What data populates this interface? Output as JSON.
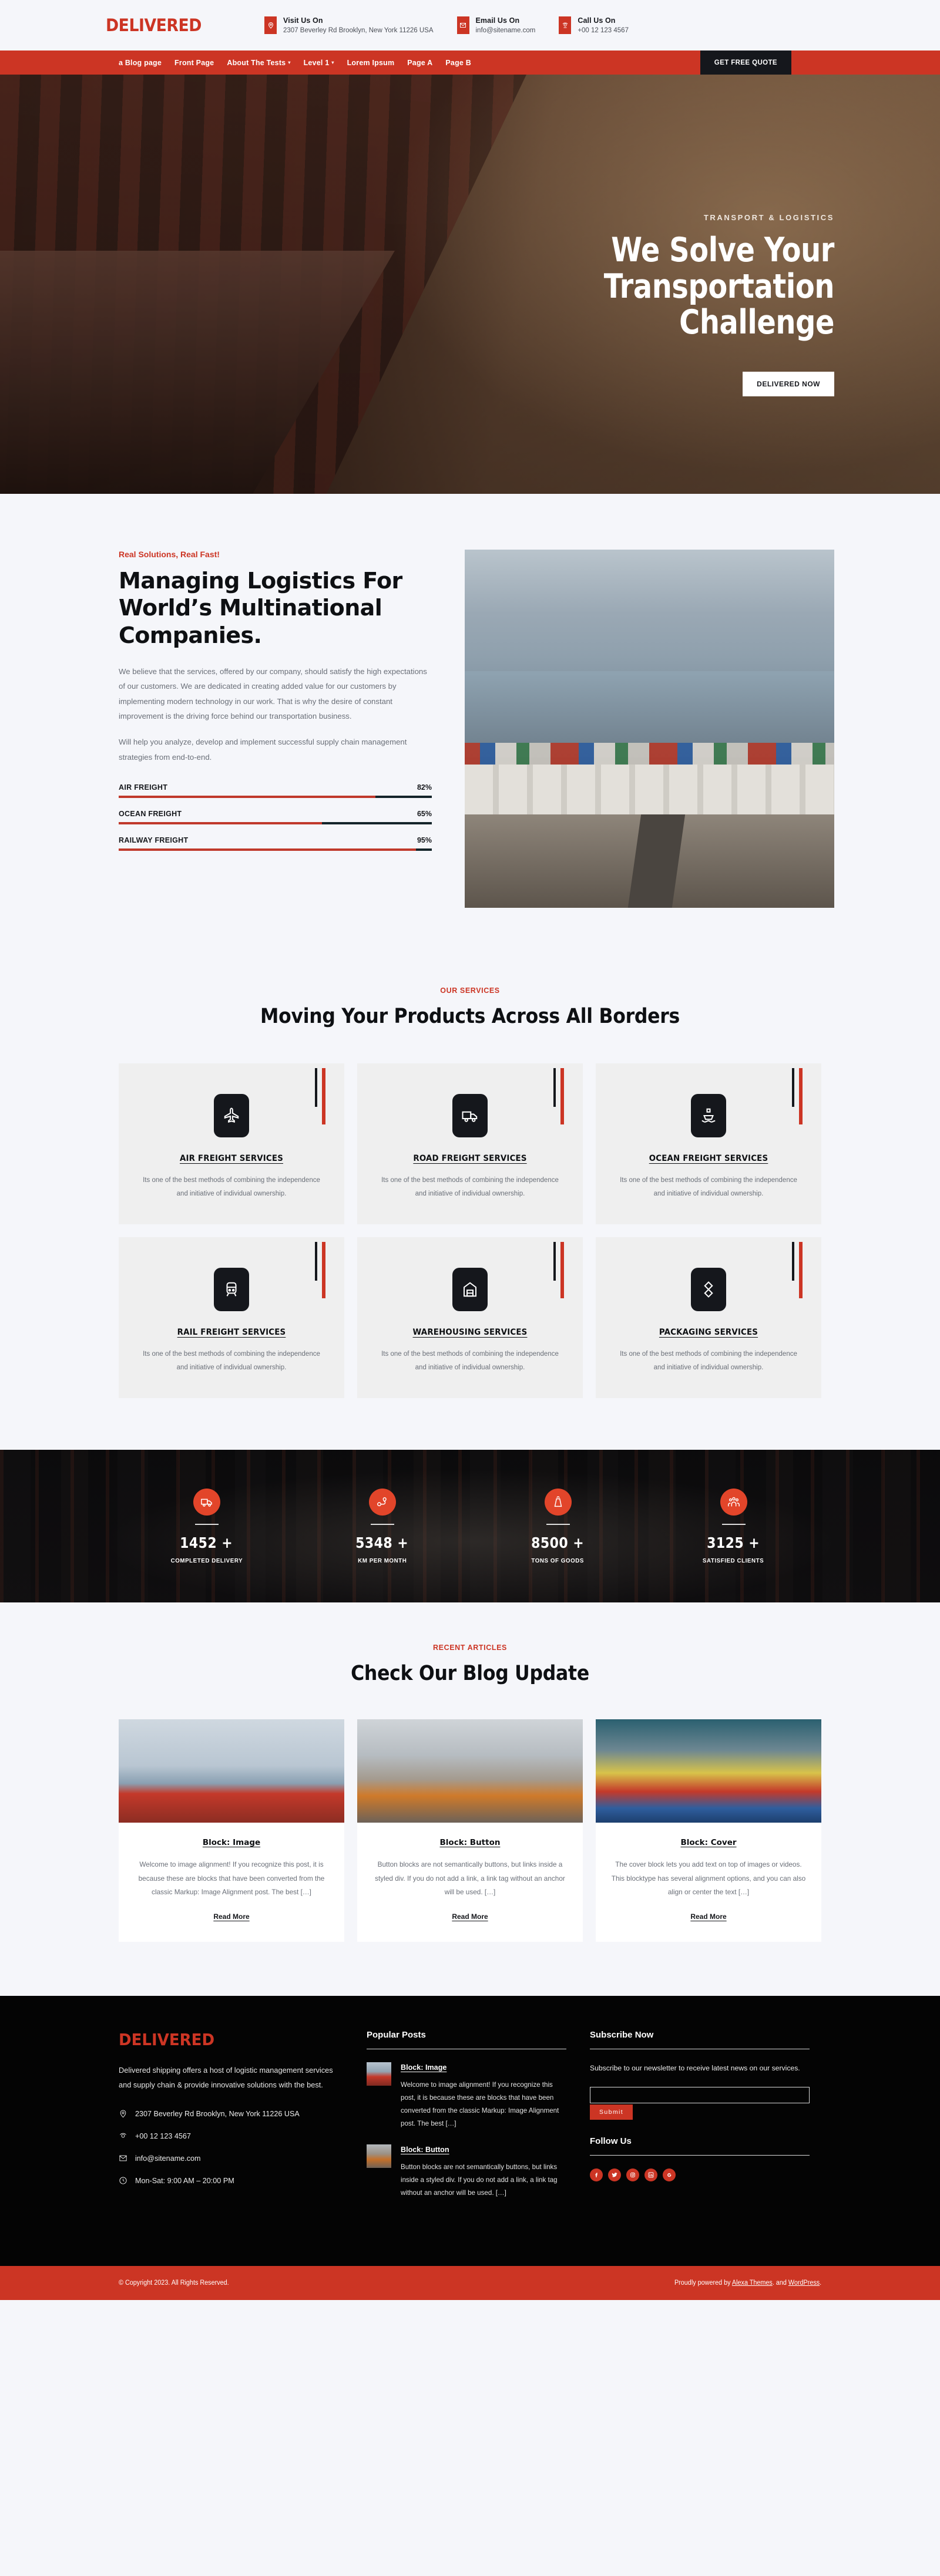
{
  "brand": {
    "name": "DELIVERED"
  },
  "topbar": {
    "contacts": [
      {
        "icon": "location-pin-icon",
        "title": "Visit Us On",
        "value": "2307 Beverley Rd Brooklyn, New York 11226 USA"
      },
      {
        "icon": "envelope-icon",
        "title": "Email Us On",
        "value": "info@sitename.com"
      },
      {
        "icon": "phone-icon",
        "title": "Call Us On",
        "value": "+00 12 123 4567"
      }
    ]
  },
  "nav": {
    "items": [
      {
        "label": "a Blog page",
        "has_dropdown": false
      },
      {
        "label": "Front Page",
        "has_dropdown": false
      },
      {
        "label": "About The Tests",
        "has_dropdown": true
      },
      {
        "label": "Level 1",
        "has_dropdown": true
      },
      {
        "label": "Lorem Ipsum",
        "has_dropdown": false
      },
      {
        "label": "Page A",
        "has_dropdown": false
      },
      {
        "label": "Page B",
        "has_dropdown": false
      }
    ],
    "cta": "GET FREE QUOTE"
  },
  "hero": {
    "eyebrow": "TRANSPORT & LOGISTICS",
    "line1": "We Solve Your",
    "line2": "Transportation Challenge",
    "button": "DELIVERED NOW"
  },
  "about": {
    "eyebrow": "Real Solutions, Real Fast!",
    "title": "Managing Logistics For World’s Multinational Companies.",
    "paragraph1": "We believe that the services, offered by our company, should satisfy the high expectations of our customers. We are dedicated in creating added value for our customers by implementing modern technology in our work. That is why the desire of constant improvement is the driving force behind our transportation business.",
    "paragraph2": "Will help you analyze, develop and implement successful supply chain management strategies from end-to-end.",
    "image_alt": "port-container-terminal-photo"
  },
  "chart_data": {
    "type": "bar",
    "title": "",
    "categories": [
      "AIR FREIGHT",
      "OCEAN FREIGHT",
      "RAILWAY FREIGHT"
    ],
    "values": [
      82,
      65,
      95
    ],
    "value_labels": [
      "82%",
      "65%",
      "95%"
    ],
    "xlabel": "",
    "ylabel": "",
    "ylim": [
      0,
      100
    ],
    "grid": false,
    "legend": "none",
    "orientation": "horizontal",
    "fill_color": "#c0392b",
    "track_color": "#14242a"
  },
  "services": {
    "eyebrow": "OUR SERVICES",
    "title": "Moving Your Products Across All Borders",
    "cards": [
      {
        "icon": "airplane-icon",
        "title": "AIR FREIGHT SERVICES",
        "text": "Its one of the best methods of combining the independence and initiative of individual ownership."
      },
      {
        "icon": "truck-icon",
        "title": "ROAD FREIGHT SERVICES",
        "text": "Its one of the best methods of combining the independence and initiative of individual ownership."
      },
      {
        "icon": "ship-icon",
        "title": "OCEAN FREIGHT SERVICES",
        "text": "Its one of the best methods of combining the independence and initiative of individual ownership."
      },
      {
        "icon": "train-icon",
        "title": "RAIL FREIGHT SERVICES",
        "text": "Its one of the best methods of combining the independence and initiative of individual ownership."
      },
      {
        "icon": "warehouse-icon",
        "title": "WAREHOUSING SERVICES",
        "text": "Its one of the best methods of combining the independence and initiative of individual ownership."
      },
      {
        "icon": "package-icon",
        "title": "PACKAGING SERVICES",
        "text": "Its one of the best methods of combining the independence and initiative of individual ownership."
      }
    ]
  },
  "stats": {
    "items": [
      {
        "icon": "delivery-truck-icon",
        "number": "1452 +",
        "label": "COMPLETED DELIVERY"
      },
      {
        "icon": "route-pin-icon",
        "number": "5348 +",
        "label": "KM PER MONTH"
      },
      {
        "icon": "weight-icon",
        "number": "8500 +",
        "label": "TONS OF GOODS"
      },
      {
        "icon": "people-group-icon",
        "number": "3125 +",
        "label": "SATISFIED CLIENTS"
      }
    ]
  },
  "blog": {
    "eyebrow": "RECENT ARTICLES",
    "title": "Check Our Blog Update",
    "posts": [
      {
        "title": "Block: Image",
        "text": "Welcome to image alignment! If you recognize this post, it is because these are blocks that have been converted from the classic Markup: Image Alignment post. The best […]",
        "more": "Read More"
      },
      {
        "title": "Block: Button",
        "text": "Button blocks are not semantically buttons, but links inside a styled div.  If you do not add a link, a link tag without an anchor will be used. […]",
        "more": "Read More"
      },
      {
        "title": "Block: Cover",
        "text": "The cover block lets you add text on top of images or videos. This blocktype has several alignment options, and you can also align or center the text […]",
        "more": "Read More"
      }
    ]
  },
  "footer": {
    "logo": "DELIVERED",
    "description": "Delivered shipping offers a host of logistic management services and supply chain & provide innovative solutions with the best.",
    "info": [
      {
        "icon": "location-pin-icon",
        "value": "2307 Beverley Rd Brooklyn, New York 11226 USA"
      },
      {
        "icon": "phone-icon",
        "value": "+00 12 123 4567"
      },
      {
        "icon": "envelope-icon",
        "value": "info@sitename.com"
      },
      {
        "icon": "clock-icon",
        "value": "Mon-Sat: 9:00 AM – 20:00 PM"
      }
    ],
    "popular_heading": "Popular Posts",
    "popular_posts": [
      {
        "title": "Block: Image",
        "text": "Welcome to image alignment! If you recognize this post, it is because these are blocks that have been converted from the classic Markup: Image Alignment post. The best […]"
      },
      {
        "title": "Block: Button",
        "text": "Button blocks are not semantically buttons, but links inside a styled div.  If you do not add a link, a link tag without an anchor will be used. […]"
      }
    ],
    "subscribe_heading": "Subscribe Now",
    "subscribe_text": "Subscribe to our newsletter to receive latest news on our services.",
    "subscribe_value": "",
    "subscribe_placeholder": "",
    "subscribe_button": "Submit",
    "follow_heading": "Follow Us",
    "social": [
      {
        "icon": "facebook-icon",
        "label": "f"
      },
      {
        "icon": "twitter-icon",
        "label": "t"
      },
      {
        "icon": "instagram-icon",
        "label": "i"
      },
      {
        "icon": "linkedin-icon",
        "label": "in"
      },
      {
        "icon": "google-icon",
        "label": "G"
      }
    ]
  },
  "copyright": {
    "left": "© Copyright 2023. All Rights Reserved.",
    "right_prefix": "Proudly powered by ",
    "right_link1": "Alexa Themes",
    "right_mid": ". and ",
    "right_link2": "WordPress",
    "right_suffix": "."
  },
  "colors": {
    "accent": "#cc3524",
    "dark": "#15171c",
    "bg": "#f5f6fa",
    "stat_circle": "#e2452a"
  }
}
